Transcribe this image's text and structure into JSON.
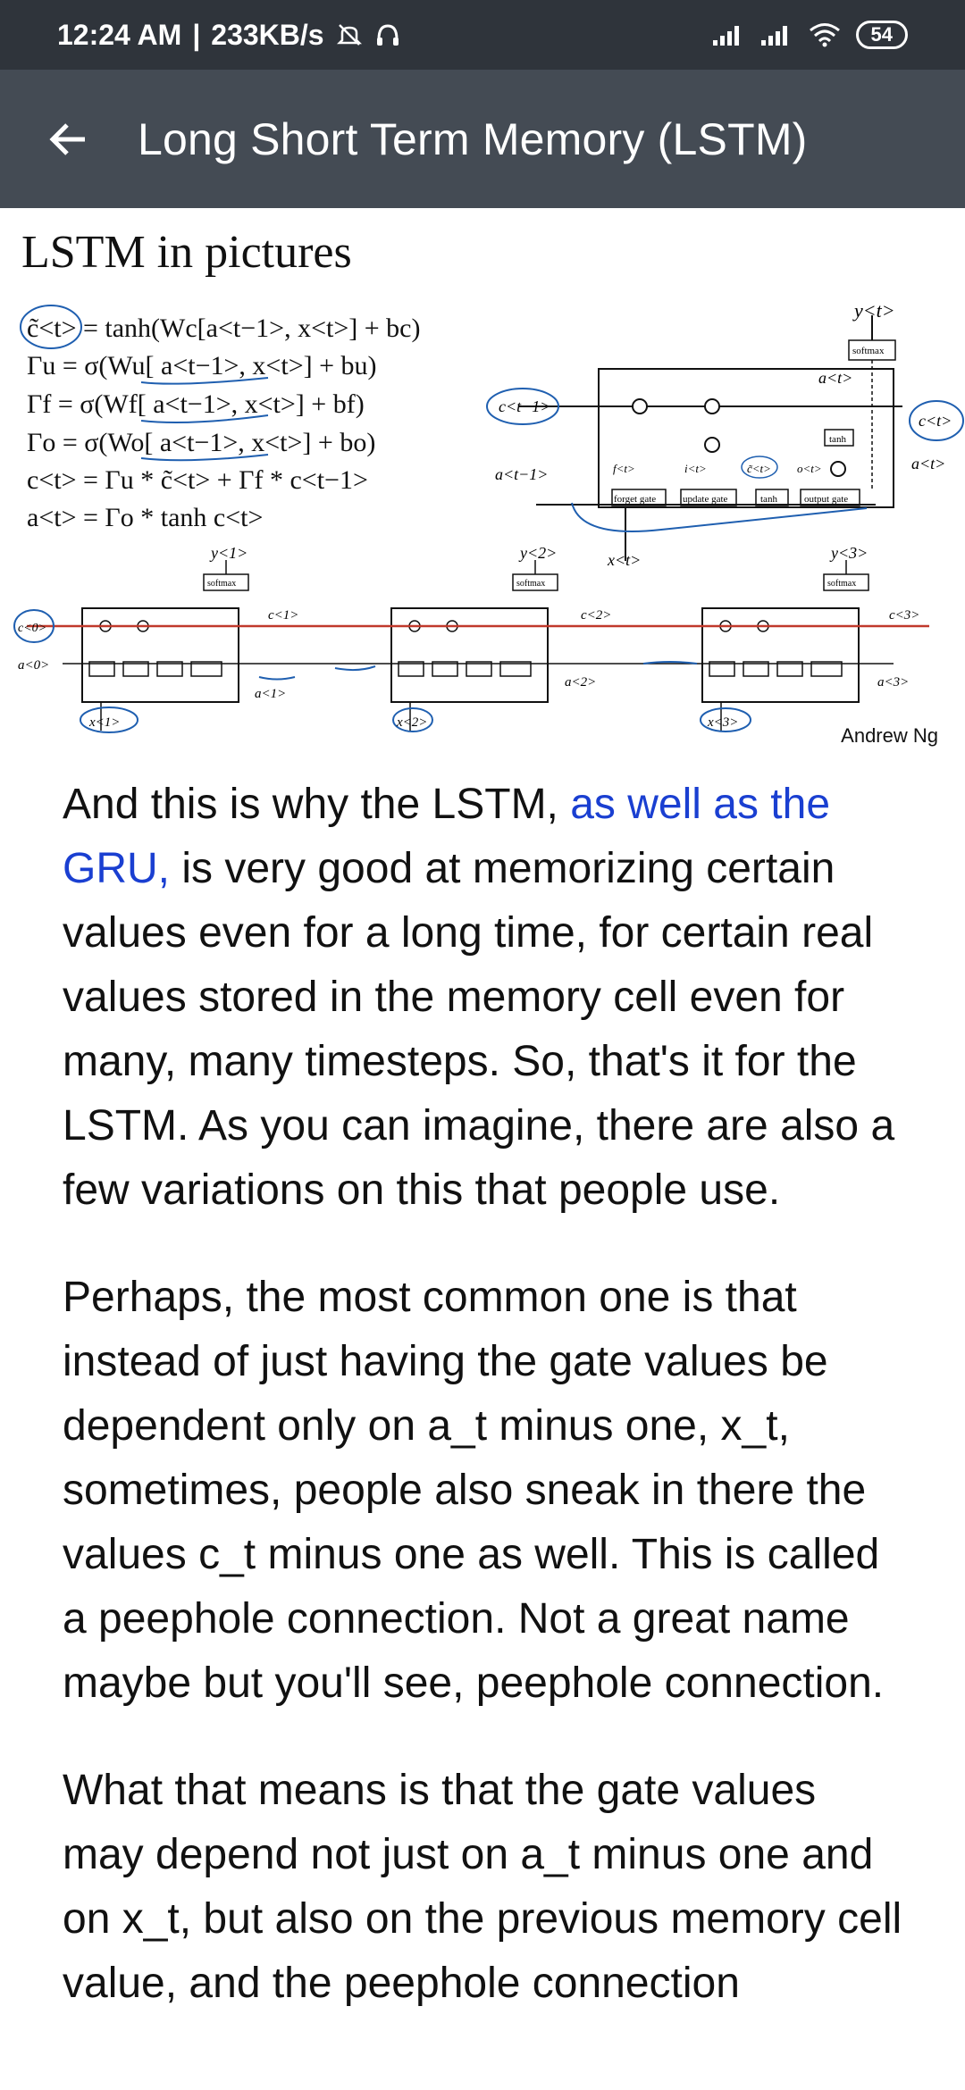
{
  "status_bar": {
    "time": "12:24 AM",
    "separator": "|",
    "network_speed": "233KB/s",
    "battery": "54",
    "icons": [
      "mute-icon",
      "headphone-icon",
      "signal-icon",
      "signal-icon",
      "wifi-icon",
      "battery-icon"
    ]
  },
  "app_bar": {
    "title": "Long Short Term Memory (LSTM)",
    "back_icon": "back-arrow-icon"
  },
  "slide": {
    "title": "LSTM in pictures",
    "author": "Andrew Ng",
    "equations": [
      "c̃<t> = tanh(Wc[a<t−1>, x<t>] + bc)",
      "Γu = σ(Wu[ a<t−1>, x<t>] + bu)",
      "Γf = σ(Wf[ a<t−1>, x<t>] + bf)",
      "Γo = σ(Wo[ a<t−1>, x<t>] + bo)",
      "c<t> = Γu * c̃<t> + Γf * c<t−1>",
      "a<t> = Γo * tanh c<t>"
    ],
    "cell_labels": {
      "y_t": "y<t>",
      "softmax": "softmax",
      "a_t": "a<t>",
      "c_prev": "c<t−1>",
      "c_t": "c<t>",
      "a_prev": "a<t−1>",
      "x_t": "x<t>",
      "tanh": "tanh",
      "gates": [
        "forget gate",
        "update gate",
        "tanh",
        "output gate"
      ],
      "gate_symbols": [
        "f<t>",
        "i<t>",
        "c̃<t>",
        "o<t>"
      ]
    },
    "chain": [
      {
        "y": "y<1>",
        "c": "c<1>",
        "a": "a<1>",
        "x": "x<1>"
      },
      {
        "y": "y<2>",
        "c": "c<2>",
        "a": "a<2>",
        "x": "x<2>"
      },
      {
        "y": "y<3>",
        "c": "c<3>",
        "a": "a<3>",
        "x": "x<3>"
      }
    ],
    "chain_inputs": {
      "c0": "c<0>",
      "a0": "a<0>"
    }
  },
  "content": {
    "p1_before": "And this is why the LSTM, ",
    "p1_link": "as well as the GRU,",
    "p1_after": " is very good at memorizing certain values even for a long time, for certain real values stored in the memory cell even for many, many timesteps. So, that's it for the LSTM. As you can imagine, there are also a few variations on this that people use.",
    "p2": "Perhaps, the most common one is that instead of just having the gate values be dependent only on a_t minus one, x_t, sometimes, people also sneak in there the values c_t minus one as well. This is called a peephole connection. Not a great name maybe but you'll see, peephole connection.",
    "p3": "What that means is that the gate values may depend not just on a_t minus one and on x_t, but also on the previous memory cell value, and the peephole connection"
  },
  "colors": {
    "status_bar_bg": "#2f343b",
    "app_bar_bg": "#444b54",
    "link": "#1a3fd1",
    "annotation_blue": "#1f5fb0",
    "annotation_red": "#c0392b"
  }
}
